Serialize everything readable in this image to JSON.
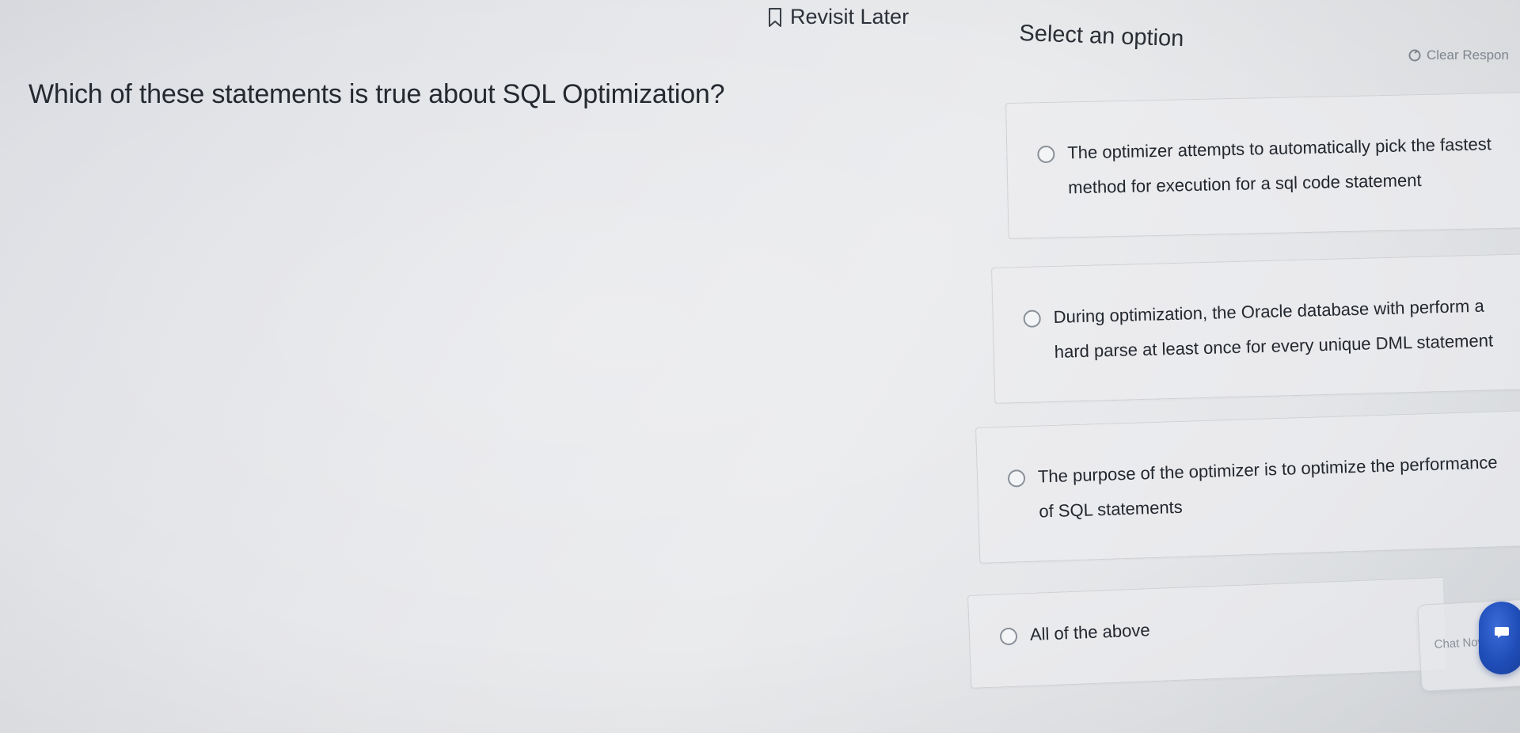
{
  "header": {
    "revisit_label": "Revisit Later",
    "revisit_icon": "bookmark-icon",
    "select_label": "Select an option",
    "clear_label": "Clear Respon",
    "clear_icon": "reset-icon"
  },
  "question": {
    "text": "Which of these statements is true about SQL Optimization?"
  },
  "options": [
    {
      "text": "The optimizer attempts to automatically pick the fastest method for execution for a sql code statement"
    },
    {
      "text": "During optimization, the Oracle database with perform a hard parse at least once for every unique DML statement"
    },
    {
      "text": "The purpose of the optimizer is to optimize the performance of SQL statements"
    },
    {
      "text": "All of the above"
    }
  ],
  "chat": {
    "label": "Chat Now",
    "icon": "chat-icon",
    "accent": "#1f4db8"
  }
}
